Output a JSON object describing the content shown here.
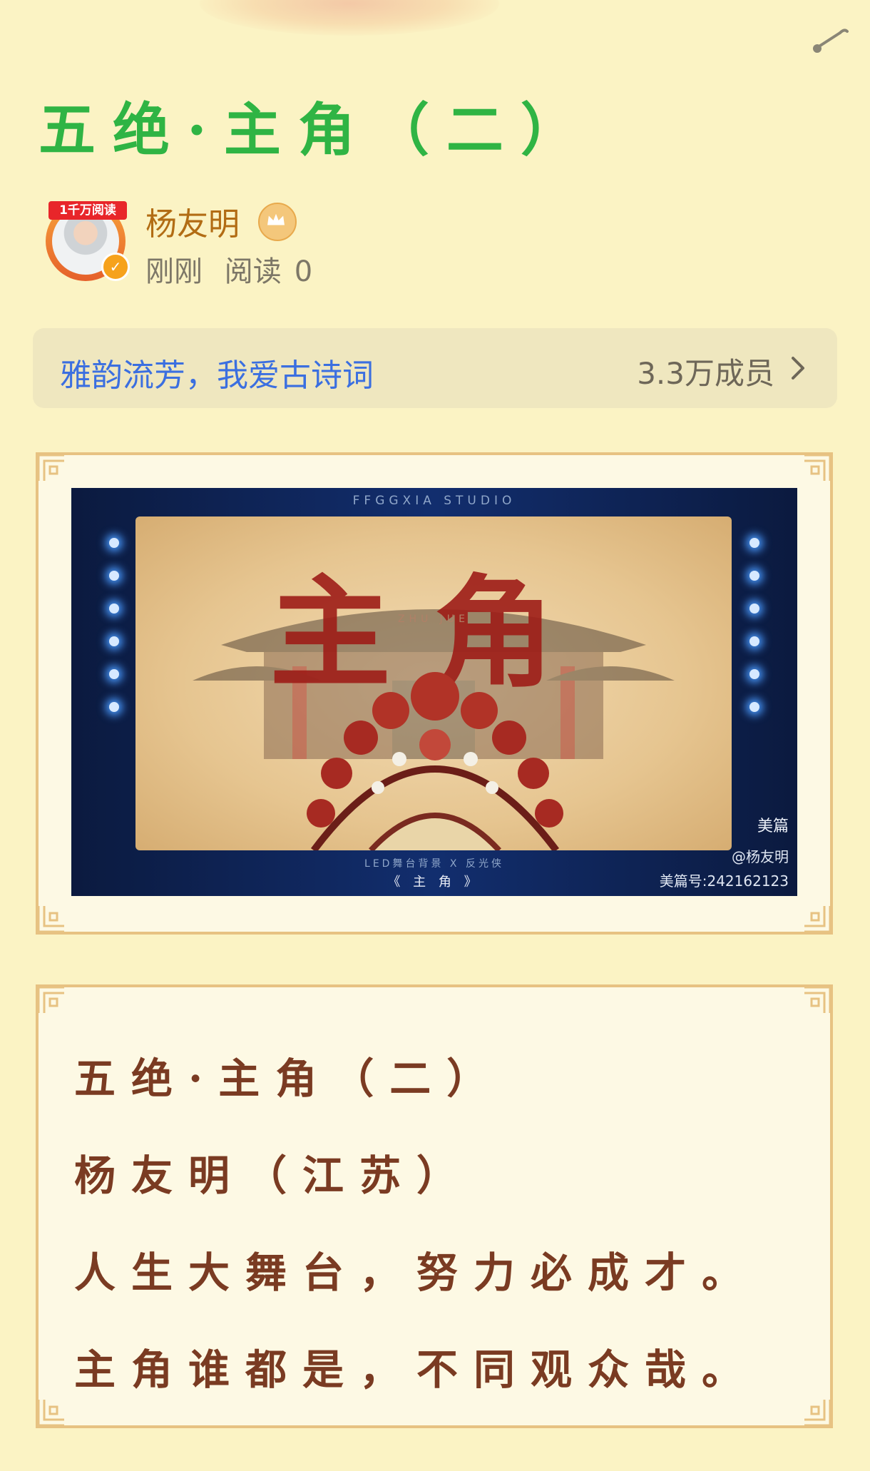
{
  "article": {
    "title": "五绝·主角（二）"
  },
  "author": {
    "badge": "1千万阅读",
    "name": "杨友明",
    "time": "刚刚",
    "reads_label": "阅读",
    "reads_count": "0"
  },
  "group": {
    "name": "雅韵流芳，我爱古诗词",
    "members": "3.3万成员"
  },
  "photo": {
    "studio_text": "FFGGXIA  STUDIO",
    "title_chars": "主角",
    "title_pinyin": "ZHU JUE",
    "caption_small": "LED舞台背景 X 反光侠",
    "caption_main": "《 主 角 》",
    "watermark_brand": "美篇",
    "watermark_user": "@杨友明",
    "watermark_id": "美篇号:242162123"
  },
  "poem": {
    "lines": [
      "五绝·主角（二）",
      "杨友明（江苏）",
      "人生大舞台，努力必成才。",
      "主角谁都是，不同观众哉。"
    ]
  },
  "colors": {
    "page_bg": "#fbf3c4",
    "title_green": "#2fb444",
    "author_gold": "#b26c14",
    "group_link_blue": "#3b6fe0",
    "frame_border": "#e7c282",
    "poem_brown": "#7a3b22"
  },
  "icons": {
    "music": "music-note-icon",
    "crown": "crown-icon",
    "verified": "verified-icon",
    "chevron": "chevron-right-icon"
  }
}
